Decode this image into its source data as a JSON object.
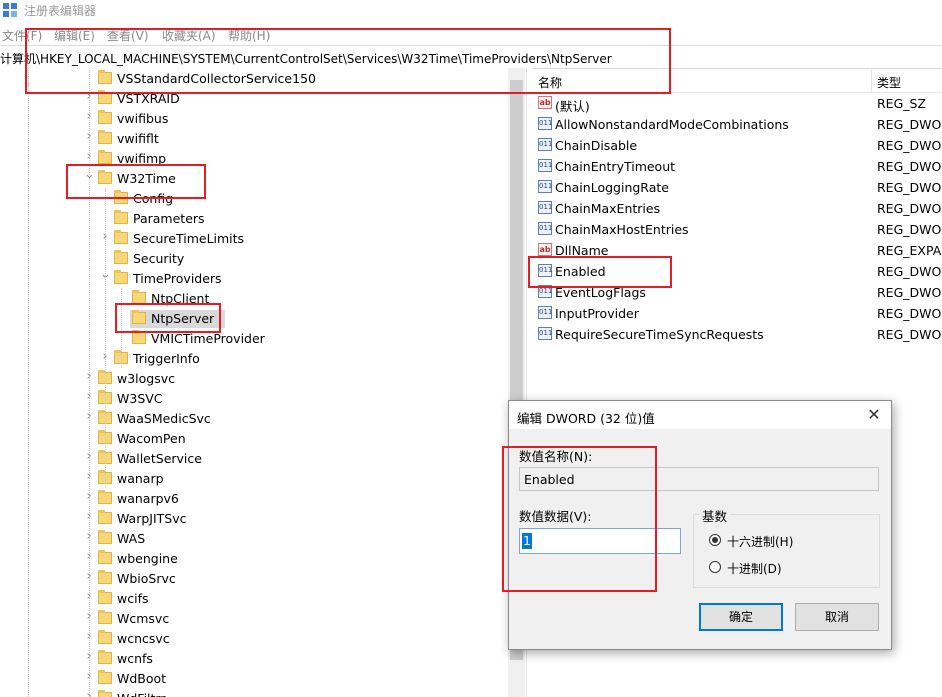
{
  "window": {
    "title": "注册表编辑器"
  },
  "menu": [
    "文件(F)",
    "编辑(E)",
    "查看(V)",
    "收藏夹(A)",
    "帮助(H)"
  ],
  "address": "计算机\\HKEY_LOCAL_MACHINE\\SYSTEM\\CurrentControlSet\\Services\\W32Time\\TimeProviders\\NtpServer",
  "tree": [
    {
      "label": "VSStandardCollectorService150",
      "level": 0,
      "chevron": "",
      "selected": false
    },
    {
      "label": "VSTXRAID",
      "level": 0,
      "chevron": "right",
      "selected": false
    },
    {
      "label": "vwifibus",
      "level": 0,
      "chevron": "right",
      "selected": false
    },
    {
      "label": "vwififlt",
      "level": 0,
      "chevron": "right",
      "selected": false
    },
    {
      "label": "vwifimp",
      "level": 0,
      "chevron": "right",
      "selected": false
    },
    {
      "label": "W32Time",
      "level": 0,
      "chevron": "down",
      "selected": false
    },
    {
      "label": "Config",
      "level": 1,
      "chevron": "",
      "selected": false
    },
    {
      "label": "Parameters",
      "level": 1,
      "chevron": "",
      "selected": false
    },
    {
      "label": "SecureTimeLimits",
      "level": 1,
      "chevron": "right",
      "selected": false
    },
    {
      "label": "Security",
      "level": 1,
      "chevron": "",
      "selected": false
    },
    {
      "label": "TimeProviders",
      "level": 1,
      "chevron": "down",
      "selected": false
    },
    {
      "label": "NtpClient",
      "level": 2,
      "chevron": "",
      "selected": false
    },
    {
      "label": "NtpServer",
      "level": 2,
      "chevron": "",
      "selected": true
    },
    {
      "label": "VMICTimeProvider",
      "level": 2,
      "chevron": "",
      "selected": false
    },
    {
      "label": "TriggerInfo",
      "level": 1,
      "chevron": "right",
      "selected": false
    },
    {
      "label": "w3logsvc",
      "level": 0,
      "chevron": "right",
      "selected": false
    },
    {
      "label": "W3SVC",
      "level": 0,
      "chevron": "right",
      "selected": false
    },
    {
      "label": "WaaSMedicSvc",
      "level": 0,
      "chevron": "right",
      "selected": false
    },
    {
      "label": "WacomPen",
      "level": 0,
      "chevron": "",
      "selected": false
    },
    {
      "label": "WalletService",
      "level": 0,
      "chevron": "right",
      "selected": false
    },
    {
      "label": "wanarp",
      "level": 0,
      "chevron": "right",
      "selected": false
    },
    {
      "label": "wanarpv6",
      "level": 0,
      "chevron": "right",
      "selected": false
    },
    {
      "label": "WarpJITSvc",
      "level": 0,
      "chevron": "right",
      "selected": false
    },
    {
      "label": "WAS",
      "level": 0,
      "chevron": "right",
      "selected": false
    },
    {
      "label": "wbengine",
      "level": 0,
      "chevron": "right",
      "selected": false
    },
    {
      "label": "WbioSrvc",
      "level": 0,
      "chevron": "right",
      "selected": false
    },
    {
      "label": "wcifs",
      "level": 0,
      "chevron": "right",
      "selected": false
    },
    {
      "label": "Wcmsvc",
      "level": 0,
      "chevron": "right",
      "selected": false
    },
    {
      "label": "wcncsvc",
      "level": 0,
      "chevron": "right",
      "selected": false
    },
    {
      "label": "wcnfs",
      "level": 0,
      "chevron": "right",
      "selected": false
    },
    {
      "label": "WdBoot",
      "level": 0,
      "chevron": "right",
      "selected": false
    },
    {
      "label": "WdFiltrr",
      "level": 0,
      "chevron": "right",
      "selected": false
    }
  ],
  "values_header": {
    "name": "名称",
    "type": "类型"
  },
  "values": [
    {
      "name": "(默认)",
      "type": "REG_SZ",
      "icon": "ab"
    },
    {
      "name": "AllowNonstandardModeCombinations",
      "type": "REG_DWORD",
      "icon": "bin"
    },
    {
      "name": "ChainDisable",
      "type": "REG_DWORD",
      "icon": "bin"
    },
    {
      "name": "ChainEntryTimeout",
      "type": "REG_DWORD",
      "icon": "bin"
    },
    {
      "name": "ChainLoggingRate",
      "type": "REG_DWORD",
      "icon": "bin"
    },
    {
      "name": "ChainMaxEntries",
      "type": "REG_DWORD",
      "icon": "bin"
    },
    {
      "name": "ChainMaxHostEntries",
      "type": "REG_DWORD",
      "icon": "bin"
    },
    {
      "name": "DllName",
      "type": "REG_EXPAND_SZ",
      "icon": "ab"
    },
    {
      "name": "Enabled",
      "type": "REG_DWORD",
      "icon": "bin"
    },
    {
      "name": "EventLogFlags",
      "type": "REG_DWORD",
      "icon": "bin"
    },
    {
      "name": "InputProvider",
      "type": "REG_DWORD",
      "icon": "bin"
    },
    {
      "name": "RequireSecureTimeSyncRequests",
      "type": "REG_DWORD",
      "icon": "bin"
    }
  ],
  "dialog": {
    "title": "编辑 DWORD (32 位)值",
    "close_glyph": "✕",
    "name_label": "数值名称(N):",
    "name_value": "Enabled",
    "data_label": "数值数据(V):",
    "data_value": "1",
    "base_label": "基数",
    "hex_label": "十六进制(H)",
    "dec_label": "十进制(D)",
    "selected_base": "hex",
    "ok_label": "确定",
    "cancel_label": "取消"
  },
  "colors": {
    "highlight_box": "#e51c23",
    "selection": "#0078d7",
    "folder": "#f8d67a"
  }
}
